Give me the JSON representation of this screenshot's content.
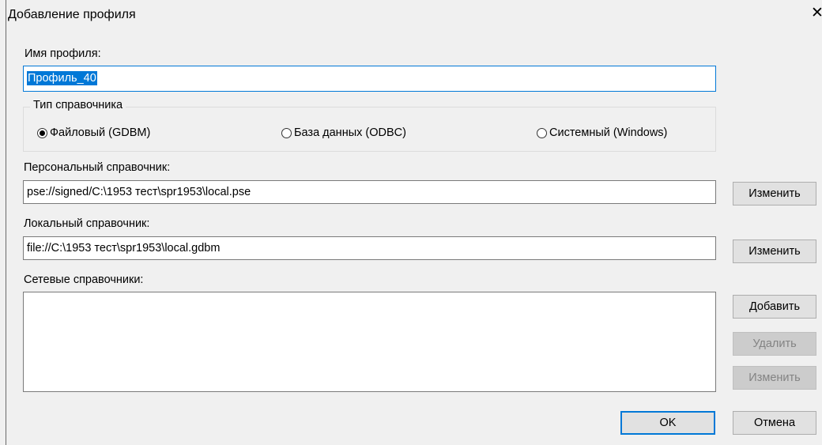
{
  "dialog": {
    "title": "Добавление профиля"
  },
  "profile": {
    "name_label": "Имя профиля:",
    "name_value": "Профиль_40"
  },
  "directory_type": {
    "legend": "Тип справочника",
    "options": [
      {
        "label": "Файловый (GDBM)",
        "checked": true
      },
      {
        "label": "База данных (ODBC)",
        "checked": false
      },
      {
        "label": "Системный (Windows)",
        "checked": false
      }
    ]
  },
  "personal": {
    "label": "Персональный справочник:",
    "value": "pse://signed/C:\\1953 тест\\spr1953\\local.pse",
    "change_label": "Изменить"
  },
  "local": {
    "label": "Локальный справочник:",
    "value": "file://C:\\1953 тест\\spr1953\\local.gdbm",
    "change_label": "Изменить"
  },
  "network": {
    "label": "Сетевые справочники:",
    "items": [],
    "add_label": "Добавить",
    "remove_label": "Удалить",
    "change_label": "Изменить",
    "remove_enabled": false,
    "change_enabled": false
  },
  "footer": {
    "ok_label": "OK",
    "cancel_label": "Отмена"
  },
  "icons": {
    "close": "close-icon"
  },
  "colors": {
    "accent": "#0078d7",
    "window_bg": "#f0f0f0",
    "disabled_text": "#838383"
  }
}
